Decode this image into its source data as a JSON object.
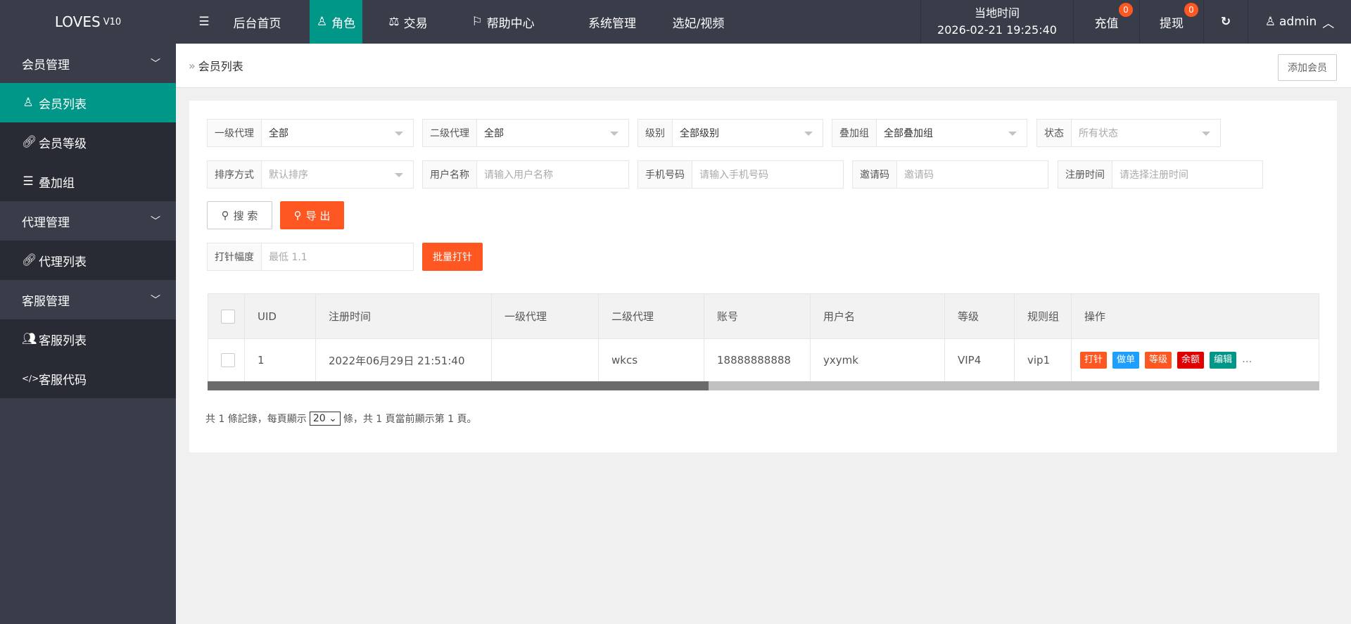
{
  "header": {
    "logo": "LOVES",
    "version": "V10",
    "nav": [
      {
        "label": "后台首页",
        "icon": ""
      },
      {
        "label": "角色",
        "icon": "user-icon"
      },
      {
        "label": "交易",
        "icon": "scale-icon"
      },
      {
        "label": "帮助中心",
        "icon": "flag-icon"
      },
      {
        "label": "系统管理",
        "icon": ""
      },
      {
        "label": "选妃/视频",
        "icon": ""
      }
    ],
    "time_label": "当地时间",
    "time_value": "2026-02-21 19:25:40",
    "recharge": "充值",
    "recharge_count": "0",
    "withdraw": "提现",
    "withdraw_count": "0",
    "user": "admin"
  },
  "sidebar": {
    "items": [
      {
        "label": "会员管理",
        "type": "group"
      },
      {
        "label": "会员列表",
        "type": "sub",
        "icon": "user-icon",
        "active": true
      },
      {
        "label": "会员等级",
        "type": "sub",
        "icon": "link-icon"
      },
      {
        "label": "叠加组",
        "type": "sub",
        "icon": "list-icon"
      },
      {
        "label": "代理管理",
        "type": "group"
      },
      {
        "label": "代理列表",
        "type": "sub",
        "icon": "link-icon"
      },
      {
        "label": "客服管理",
        "type": "group"
      },
      {
        "label": "客服列表",
        "type": "sub",
        "icon": "users-icon"
      },
      {
        "label": "客服代码",
        "type": "sub",
        "icon": "code-icon"
      }
    ]
  },
  "breadcrumb": {
    "title": "会员列表",
    "add_button": "添加会员"
  },
  "filters": {
    "agent1": {
      "label": "一级代理",
      "value": "全部"
    },
    "agent2": {
      "label": "二级代理",
      "value": "全部"
    },
    "level": {
      "label": "级别",
      "value": "全部级别"
    },
    "group": {
      "label": "叠加组",
      "value": "全部叠加组"
    },
    "status": {
      "label": "状态",
      "placeholder": "所有状态"
    },
    "sort": {
      "label": "排序方式",
      "placeholder": "默认排序"
    },
    "username": {
      "label": "用户名称",
      "placeholder": "请输入用户名称"
    },
    "phone": {
      "label": "手机号码",
      "placeholder": "请输入手机号码"
    },
    "invite": {
      "label": "邀请码",
      "placeholder": "邀请码"
    },
    "regtime": {
      "label": "注册时间",
      "placeholder": "请选择注册时间"
    },
    "search_button": "搜 索",
    "export_button": "导 出",
    "boost": {
      "label": "打针幅度",
      "placeholder": "最低 1.1"
    },
    "batch_button": "批量打针"
  },
  "table": {
    "headers": [
      "UID",
      "注册时间",
      "一级代理",
      "二级代理",
      "账号",
      "用户名",
      "等级",
      "规则组",
      "操作"
    ],
    "rows": [
      {
        "uid": "1",
        "reg_time": "2022年06月29日 21:51:40",
        "agent1": "",
        "agent2": "wkcs",
        "account": "18888888888",
        "username": "yxymk",
        "level": "VIP4",
        "group": "vip1"
      }
    ],
    "actions": [
      {
        "label": "打针",
        "color": "#FF5722"
      },
      {
        "label": "做单",
        "color": "#1E9FFF"
      },
      {
        "label": "等级",
        "color": "#FF5722"
      },
      {
        "label": "余额",
        "color": "#E10000"
      },
      {
        "label": "编辑",
        "color": "#009688"
      }
    ],
    "more": "..."
  },
  "pager": {
    "prefix": "共 1 條記錄，每頁顯示",
    "page_size": "20",
    "suffix": "條，共 1 頁當前顯示第 1 頁。"
  }
}
